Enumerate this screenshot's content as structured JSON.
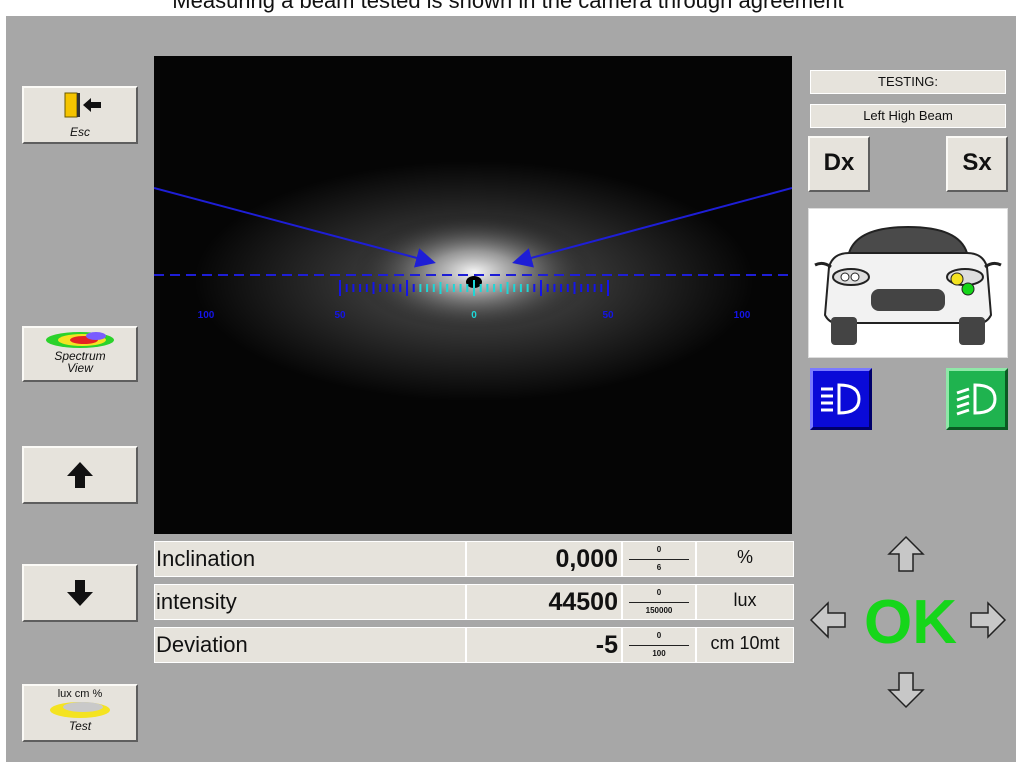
{
  "caption": "Measuring a beam tested is shown in the camera through agreement",
  "sidebar": {
    "esc_label": "Esc",
    "spectrum_label_1": "Spectrum",
    "spectrum_label_2": "View",
    "test_top_label": "lux cm %",
    "test_label": "Test"
  },
  "status": {
    "testing_label": "TESTING:",
    "beam_label": "Left High Beam"
  },
  "side_buttons": {
    "dx_label": "Dx",
    "sx_label": "Sx"
  },
  "scale": {
    "labels": [
      "100",
      "50",
      "0",
      "50",
      "100"
    ]
  },
  "measurements": [
    {
      "label": "Inclination",
      "value": "0,000",
      "range_min": "0",
      "range_max": "6",
      "unit": "%"
    },
    {
      "label": "intensity",
      "value": "44500",
      "range_min": "0",
      "range_max": "150000",
      "unit": "lux"
    },
    {
      "label": "Deviation",
      "value": "-5",
      "range_min": "0",
      "range_max": "100",
      "unit": "cm 10mt"
    }
  ],
  "result": {
    "ok_label": "OK"
  },
  "colors": {
    "ok_green": "#16d61a",
    "scale_blue": "#1414e8",
    "scale_cyan": "#1fd6d6",
    "high_beam_blue": "#0a0ad8",
    "low_beam_green": "#1fb34f"
  },
  "icons": {
    "exit": "exit-door-icon",
    "spectrum": "spectrum-heatmap-icon",
    "up": "arrow-up-icon",
    "down": "arrow-down-icon",
    "test": "lux-test-icon",
    "high_beam": "high-beam-icon",
    "low_beam": "low-beam-icon"
  }
}
